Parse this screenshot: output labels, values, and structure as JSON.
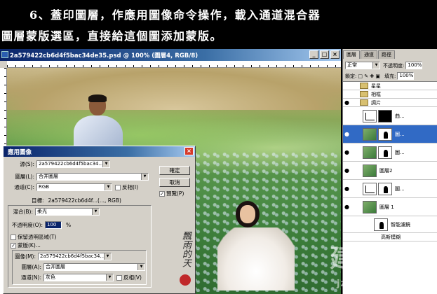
{
  "banner": {
    "line1": "6、蓋印圖層，作應用圖像命令操作，載入通道混合器",
    "line2": "圖層蒙版選區，直接給這個圖添加蒙版。"
  },
  "document": {
    "title": "2a579422cb6d4f5bac34de35.psd @ 100% (圖層4, RGB/8)",
    "signature_text": "飄雨的天"
  },
  "dialog": {
    "title": "應用圖像",
    "source_label": "源(S):",
    "source_value": "2a579422cb6d4f5bac34...",
    "layer_label": "圖層(L):",
    "layer_value": "合并圖層",
    "channel_label": "通道(C):",
    "channel_value": "RGB",
    "invert_label": "反相(I)",
    "target_label": "目標:",
    "target_value": "2a579422cb6d4f...(..., RGB)",
    "blending_label": "混合(B):",
    "blending_value": "柔光",
    "opacity_label": "不透明度(O):",
    "opacity_value": "100",
    "opacity_unit": "%",
    "preserve_label": "保留透明區域(T)",
    "mask_label": "蒙版(K)...",
    "mask_image_label": "圖像(M):",
    "mask_image_value": "2a579422cb6d4f5bac34...",
    "mask_layer_label": "圖層(A):",
    "mask_layer_value": "合并圖層",
    "mask_channel_label": "通道(N):",
    "mask_channel_value": "灰色",
    "mask_invert_label": "反相(V)",
    "ok": "確定",
    "cancel": "取消",
    "preview": "預覽(P)"
  },
  "layers_panel": {
    "tabs": [
      "圖層",
      "通道",
      "路徑"
    ],
    "blend_mode": "正常",
    "opacity_label": "不透明度:",
    "opacity_value": "100%",
    "lock_label": "鎖定:",
    "fill_label": "填充:",
    "fill_value": "100%",
    "layers": [
      {
        "name": "星星",
        "type": "folder"
      },
      {
        "name": "相框",
        "type": "folder"
      },
      {
        "name": "調片",
        "type": "folder"
      },
      {
        "name": "曲...",
        "type": "adjust-black"
      },
      {
        "name": "圖...",
        "type": "photo-mask",
        "selected": true
      },
      {
        "name": "圖...",
        "type": "photo-mask"
      },
      {
        "name": "圖層2",
        "type": "photo"
      },
      {
        "name": "圖...",
        "type": "curve-mask"
      },
      {
        "name": "圖層 1",
        "type": "photo"
      },
      {
        "name": "智能濾鏡",
        "type": "mask"
      },
      {
        "name": "高斯模糊",
        "type": "filter"
      }
    ]
  },
  "watermark": {
    "big": "建筑艺",
    "small": "jzxue.com"
  }
}
